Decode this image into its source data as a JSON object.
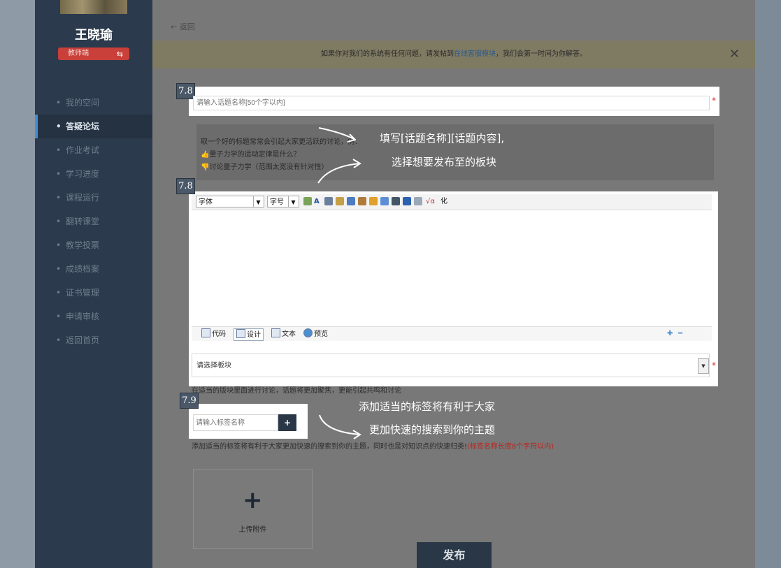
{
  "sidebar": {
    "user_name": "王晓瑜",
    "role_label": "教师端",
    "role_switch_icon": "swap-icon",
    "items": [
      {
        "label": "我的空间",
        "active": false
      },
      {
        "label": "答疑论坛",
        "active": true
      },
      {
        "label": "作业考试",
        "active": false
      },
      {
        "label": "学习进度",
        "active": false
      },
      {
        "label": "课程运行",
        "active": false
      },
      {
        "label": "翻转课堂",
        "active": false
      },
      {
        "label": "教学投票",
        "active": false
      },
      {
        "label": "成绩档案",
        "active": false
      },
      {
        "label": "证书管理",
        "active": false
      },
      {
        "label": "申请审核",
        "active": false
      },
      {
        "label": "返回首页",
        "active": false
      }
    ]
  },
  "header": {
    "back_label": "返回"
  },
  "notice": {
    "text_before": "如果你对我们的系统有任何问题，请发帖到",
    "link": "在线客服模块",
    "text_after": "，我们会第一时间为你解答。",
    "close": "✕"
  },
  "badges": {
    "title": "7.8",
    "editor": "7.8",
    "tag": "7.9"
  },
  "topic": {
    "placeholder": "请输入话题名称[50个字以内]"
  },
  "hint": {
    "line1": "取一个好的标题常常会引起大家更活跃的讨论，例：",
    "line2": "量子力学的运动定律是什么？",
    "line3": "讨论量子力学（范围太宽没有针对性）"
  },
  "annotations": {
    "a1_line1": "填写[话题名称][话题内容],",
    "a1_line2": "选择想要发布至的板块",
    "a2_line1": "添加适当的标签将有利于大家",
    "a2_line2": "更加快速的搜索到你的主题"
  },
  "editor": {
    "font_label": "字体",
    "size_label": "字号",
    "last_tool": "化",
    "modes": [
      "代码",
      "设计",
      "文本",
      "预览"
    ],
    "active_mode": "设计"
  },
  "board": {
    "placeholder": "请选择板块"
  },
  "board_hint": "在适当的版块里面进行讨论，话题将更加聚焦，更能引起共鸣和讨论",
  "tag": {
    "placeholder": "请输入标签名称",
    "add_icon": "plus-icon"
  },
  "tag_hint": {
    "text": "添加适当的标签将有利于大家更加快速的搜索到你的主题，同时也是对知识点的快速归类!",
    "red": "(标签名称长度8个字符以内)"
  },
  "upload": {
    "label": "上传附件"
  },
  "publish": {
    "label": "发布"
  },
  "colors": {
    "sidebar": "#2b3a4c",
    "active_indicator": "#3f8fd8",
    "role_button": "#c9403a",
    "publish": "#2a3747"
  }
}
